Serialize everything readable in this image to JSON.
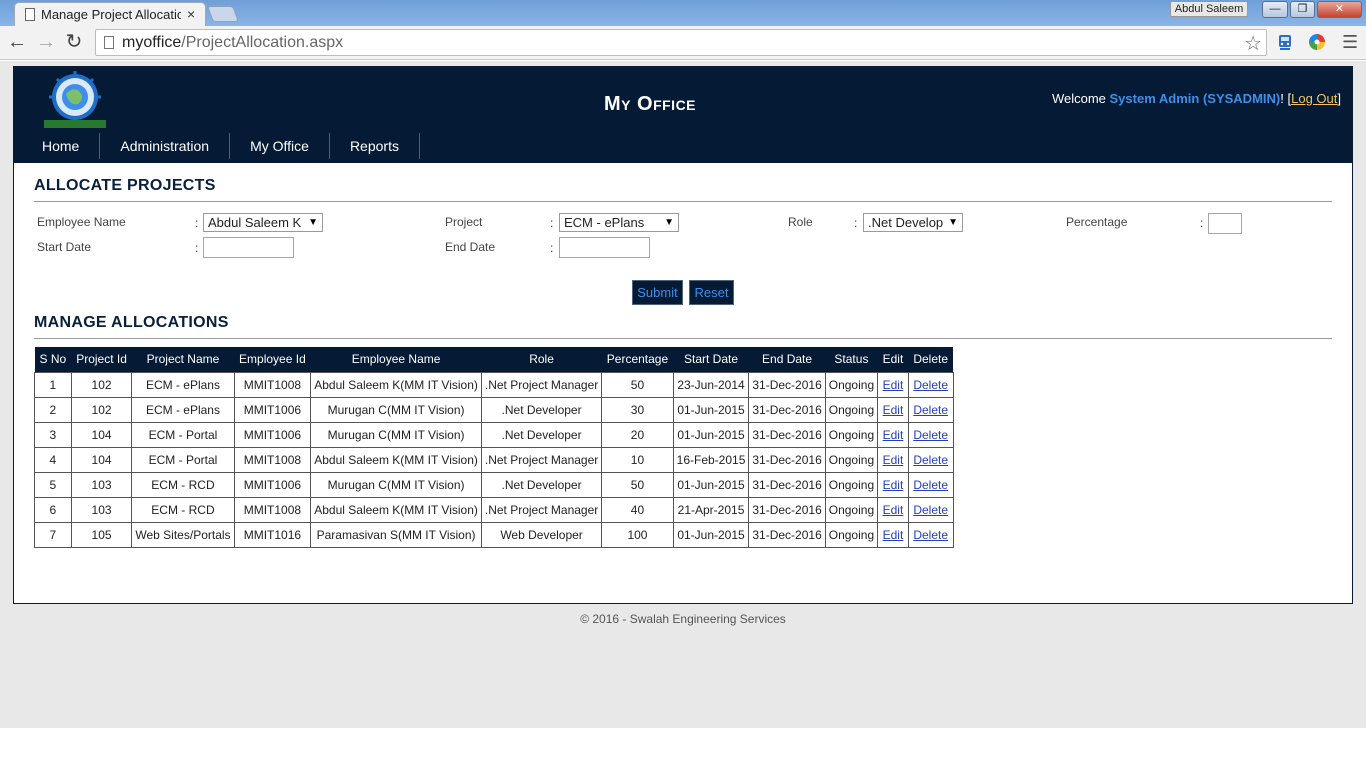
{
  "browser": {
    "tab_title": "Manage Project Allocation",
    "tab_close": "×",
    "user_badge": "Abdul Saleem",
    "window_buttons": {
      "minimize": "—",
      "maximize": "❐",
      "close": "✕"
    },
    "url_host": "myoffice",
    "url_path": "/ProjectAllocation.aspx"
  },
  "site": {
    "title": "My Office",
    "welcome": "Welcome",
    "user_name": "System Admin (SYSADMIN)",
    "excl": "!",
    "logout_open": "[",
    "logout_label": "Log Out",
    "logout_close": "]",
    "menu": [
      "Home",
      "Administration",
      "My Office",
      "Reports"
    ]
  },
  "allocate": {
    "title": "ALLOCATE PROJECTS",
    "employee_label": "Employee Name",
    "employee_value": "Abdul Saleem K",
    "project_label": "Project",
    "project_value": "ECM - ePlans",
    "role_label": "Role",
    "role_value": ".Net Develop",
    "percentage_label": "Percentage",
    "percentage_value": "",
    "start_label": "Start Date",
    "start_value": "",
    "end_label": "End Date",
    "end_value": "",
    "colon": ":",
    "submit": "Submit",
    "reset": "Reset"
  },
  "manage": {
    "title": "MANAGE ALLOCATIONS",
    "columns": [
      "S No",
      "Project Id",
      "Project Name",
      "Employee Id",
      "Employee Name",
      "Role",
      "Percentage",
      "Start Date",
      "End Date",
      "Status",
      "Edit",
      "Delete"
    ],
    "rows": [
      [
        "1",
        "102",
        "ECM - ePlans",
        "MMIT1008",
        "Abdul Saleem K(MM IT Vision)",
        ".Net Project Manager",
        "50",
        "23-Jun-2014",
        "31-Dec-2016",
        "Ongoing",
        "Edit",
        "Delete"
      ],
      [
        "2",
        "102",
        "ECM - ePlans",
        "MMIT1006",
        "Murugan C(MM IT Vision)",
        ".Net Developer",
        "30",
        "01-Jun-2015",
        "31-Dec-2016",
        "Ongoing",
        "Edit",
        "Delete"
      ],
      [
        "3",
        "104",
        "ECM - Portal",
        "MMIT1006",
        "Murugan C(MM IT Vision)",
        ".Net Developer",
        "20",
        "01-Jun-2015",
        "31-Dec-2016",
        "Ongoing",
        "Edit",
        "Delete"
      ],
      [
        "4",
        "104",
        "ECM - Portal",
        "MMIT1008",
        "Abdul Saleem K(MM IT Vision)",
        ".Net Project Manager",
        "10",
        "16-Feb-2015",
        "31-Dec-2016",
        "Ongoing",
        "Edit",
        "Delete"
      ],
      [
        "5",
        "103",
        "ECM - RCD",
        "MMIT1006",
        "Murugan C(MM IT Vision)",
        ".Net Developer",
        "50",
        "01-Jun-2015",
        "31-Dec-2016",
        "Ongoing",
        "Edit",
        "Delete"
      ],
      [
        "6",
        "103",
        "ECM - RCD",
        "MMIT1008",
        "Abdul Saleem K(MM IT Vision)",
        ".Net Project Manager",
        "40",
        "21-Apr-2015",
        "31-Dec-2016",
        "Ongoing",
        "Edit",
        "Delete"
      ],
      [
        "7",
        "105",
        "Web Sites/Portals",
        "MMIT1016",
        "Paramasivan S(MM IT Vision)",
        "Web Developer",
        "100",
        "01-Jun-2015",
        "31-Dec-2016",
        "Ongoing",
        "Edit",
        "Delete"
      ]
    ]
  },
  "footer": "© 2016 - Swalah Engineering Services",
  "colors": {
    "header_bg": "#041a35",
    "link_blue": "#3f8fe8",
    "logout_gold": "#f3c45b"
  }
}
